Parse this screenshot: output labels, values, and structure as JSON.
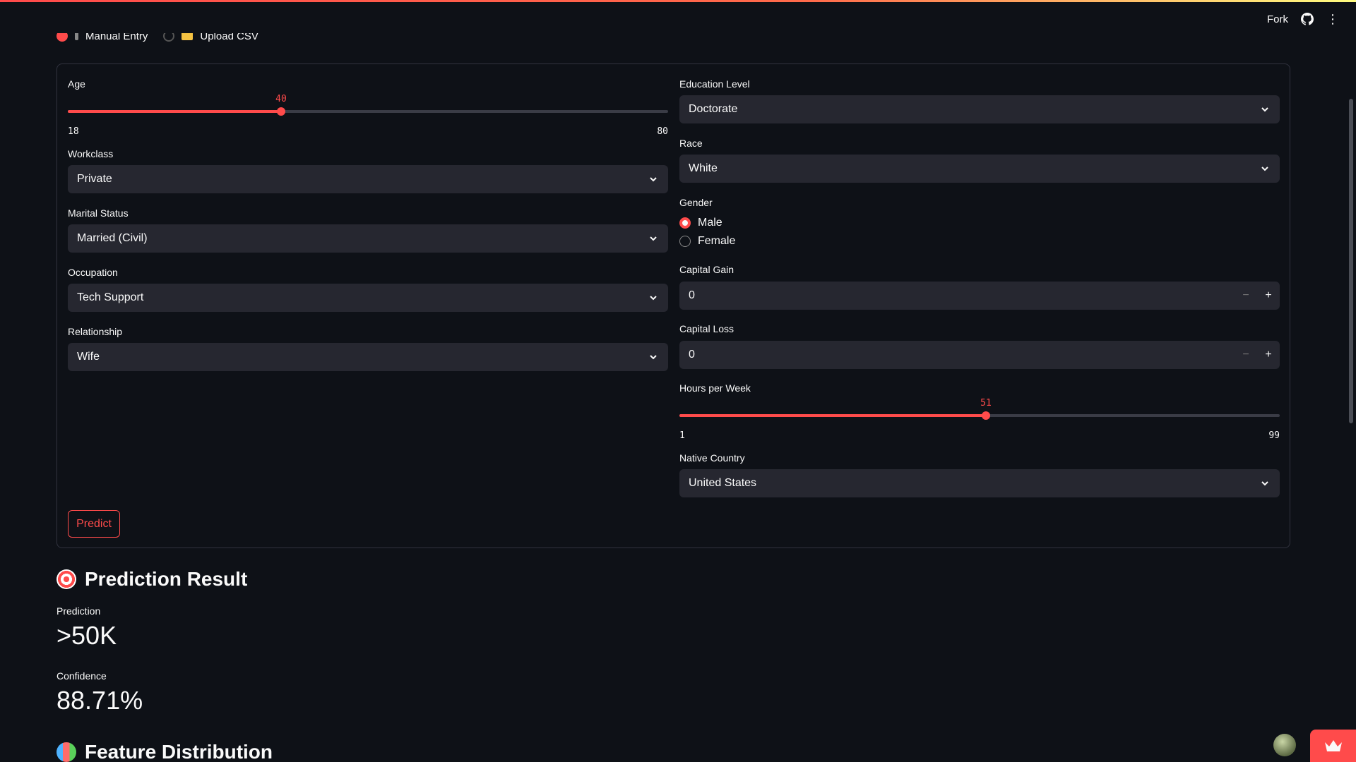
{
  "header": {
    "fork_label": "Fork",
    "github_icon": "github-icon",
    "menu_icon": "kebab-menu-icon"
  },
  "mode": {
    "options": [
      "Manual Entry",
      "Upload CSV"
    ],
    "selected": "Manual Entry"
  },
  "form": {
    "age": {
      "label": "Age",
      "value": "40",
      "min": "18",
      "max": "80"
    },
    "workclass": {
      "label": "Workclass",
      "value": "Private"
    },
    "marital_status": {
      "label": "Marital Status",
      "value": "Married (Civil)"
    },
    "occupation": {
      "label": "Occupation",
      "value": "Tech Support"
    },
    "relationship": {
      "label": "Relationship",
      "value": "Wife"
    },
    "education": {
      "label": "Education Level",
      "value": "Doctorate"
    },
    "race": {
      "label": "Race",
      "value": "White"
    },
    "gender": {
      "label": "Gender",
      "options": [
        "Male",
        "Female"
      ],
      "selected": "Male"
    },
    "capital_gain": {
      "label": "Capital Gain",
      "value": "0"
    },
    "capital_loss": {
      "label": "Capital Loss",
      "value": "0"
    },
    "hours": {
      "label": "Hours per Week",
      "value": "51",
      "min": "1",
      "max": "99"
    },
    "country": {
      "label": "Native Country",
      "value": "United States"
    },
    "predict_label": "Predict"
  },
  "result": {
    "heading": "Prediction Result",
    "prediction_label": "Prediction",
    "prediction_value": ">50K",
    "confidence_label": "Confidence",
    "confidence_value": "88.71%"
  },
  "distribution": {
    "heading": "Feature Distribution"
  },
  "colors": {
    "accent": "#ff4b4b",
    "background": "#0e1117",
    "input_bg": "#262730"
  }
}
